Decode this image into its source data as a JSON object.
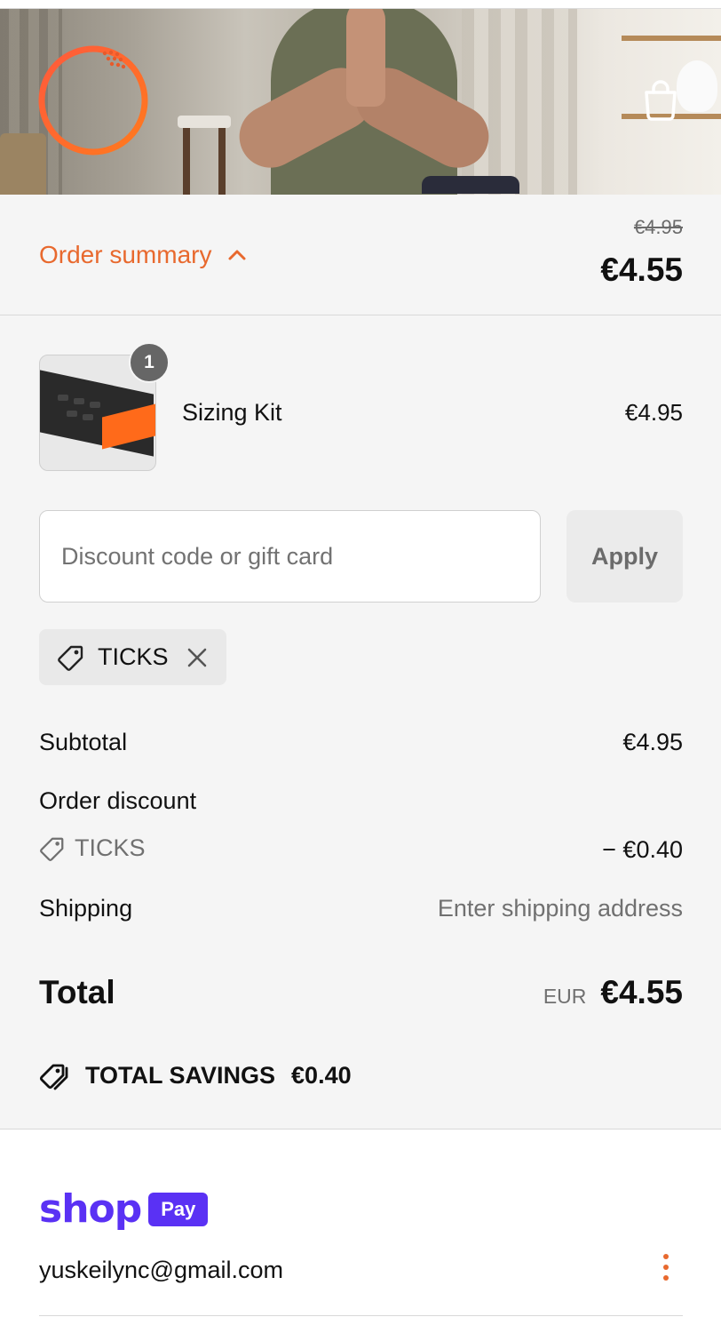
{
  "brand": {
    "accent_color": "#e8692e",
    "logo_icon": "ring-logo-icon",
    "cart_icon": "shopping-bag-icon"
  },
  "summary": {
    "toggle_label": "Order summary",
    "toggle_icon": "chevron-up-icon",
    "original_price": "€4.95",
    "current_price": "€4.55"
  },
  "line_item": {
    "quantity": "1",
    "name": "Sizing Kit",
    "price": "€4.95"
  },
  "discount": {
    "placeholder": "Discount code or gift card",
    "value": "",
    "apply_label": "Apply",
    "applied_code": "TICKS",
    "tag_icon": "tag-icon",
    "remove_icon": "close-icon"
  },
  "totals": {
    "subtotal_label": "Subtotal",
    "subtotal_value": "€4.95",
    "order_discount_label": "Order discount",
    "discount_code": "TICKS",
    "discount_value": "− €0.40",
    "shipping_label": "Shipping",
    "shipping_value": "Enter shipping address",
    "total_label": "Total",
    "currency": "EUR",
    "total_value": "€4.55",
    "savings_label": "TOTAL SAVINGS",
    "savings_value": "€0.40"
  },
  "shop_pay": {
    "wordmark": "shop",
    "badge": "Pay",
    "brand_color": "#5a31f4",
    "email": "yuskeilync@gmail.com",
    "menu_icon": "more-vertical-icon"
  }
}
